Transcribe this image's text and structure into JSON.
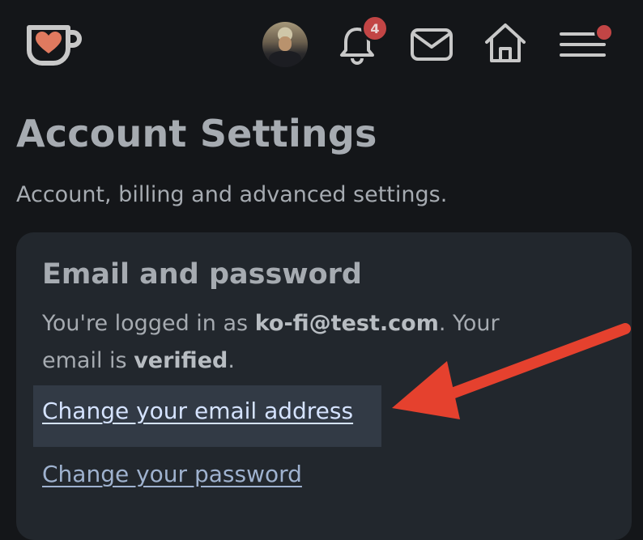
{
  "header": {
    "logo_icon": "kofi-heart-cup-icon",
    "avatar_icon": "user-avatar",
    "notifications": {
      "icon": "bell-icon",
      "count": "4"
    },
    "mail_icon": "mail-icon",
    "home_icon": "home-icon",
    "menu_icon": "hamburger-menu-icon"
  },
  "page": {
    "title": "Account Settings",
    "subtitle": "Account, billing and advanced settings."
  },
  "card": {
    "title": "Email and password",
    "text_prefix": "You're logged in as ",
    "email": "ko-fi@test.com",
    "text_middle": ". Your email is ",
    "status": "verified",
    "text_suffix": ".",
    "change_email_label": "Change your email address",
    "change_password_label": "Change your password"
  },
  "annotation": {
    "icon": "red-arrow-icon",
    "color": "#e5412e"
  },
  "colors": {
    "background": "#141619",
    "card": "#22272d",
    "badge": "#c24545",
    "link_active": "#d5e3ff",
    "link": "#9fb2cf"
  }
}
